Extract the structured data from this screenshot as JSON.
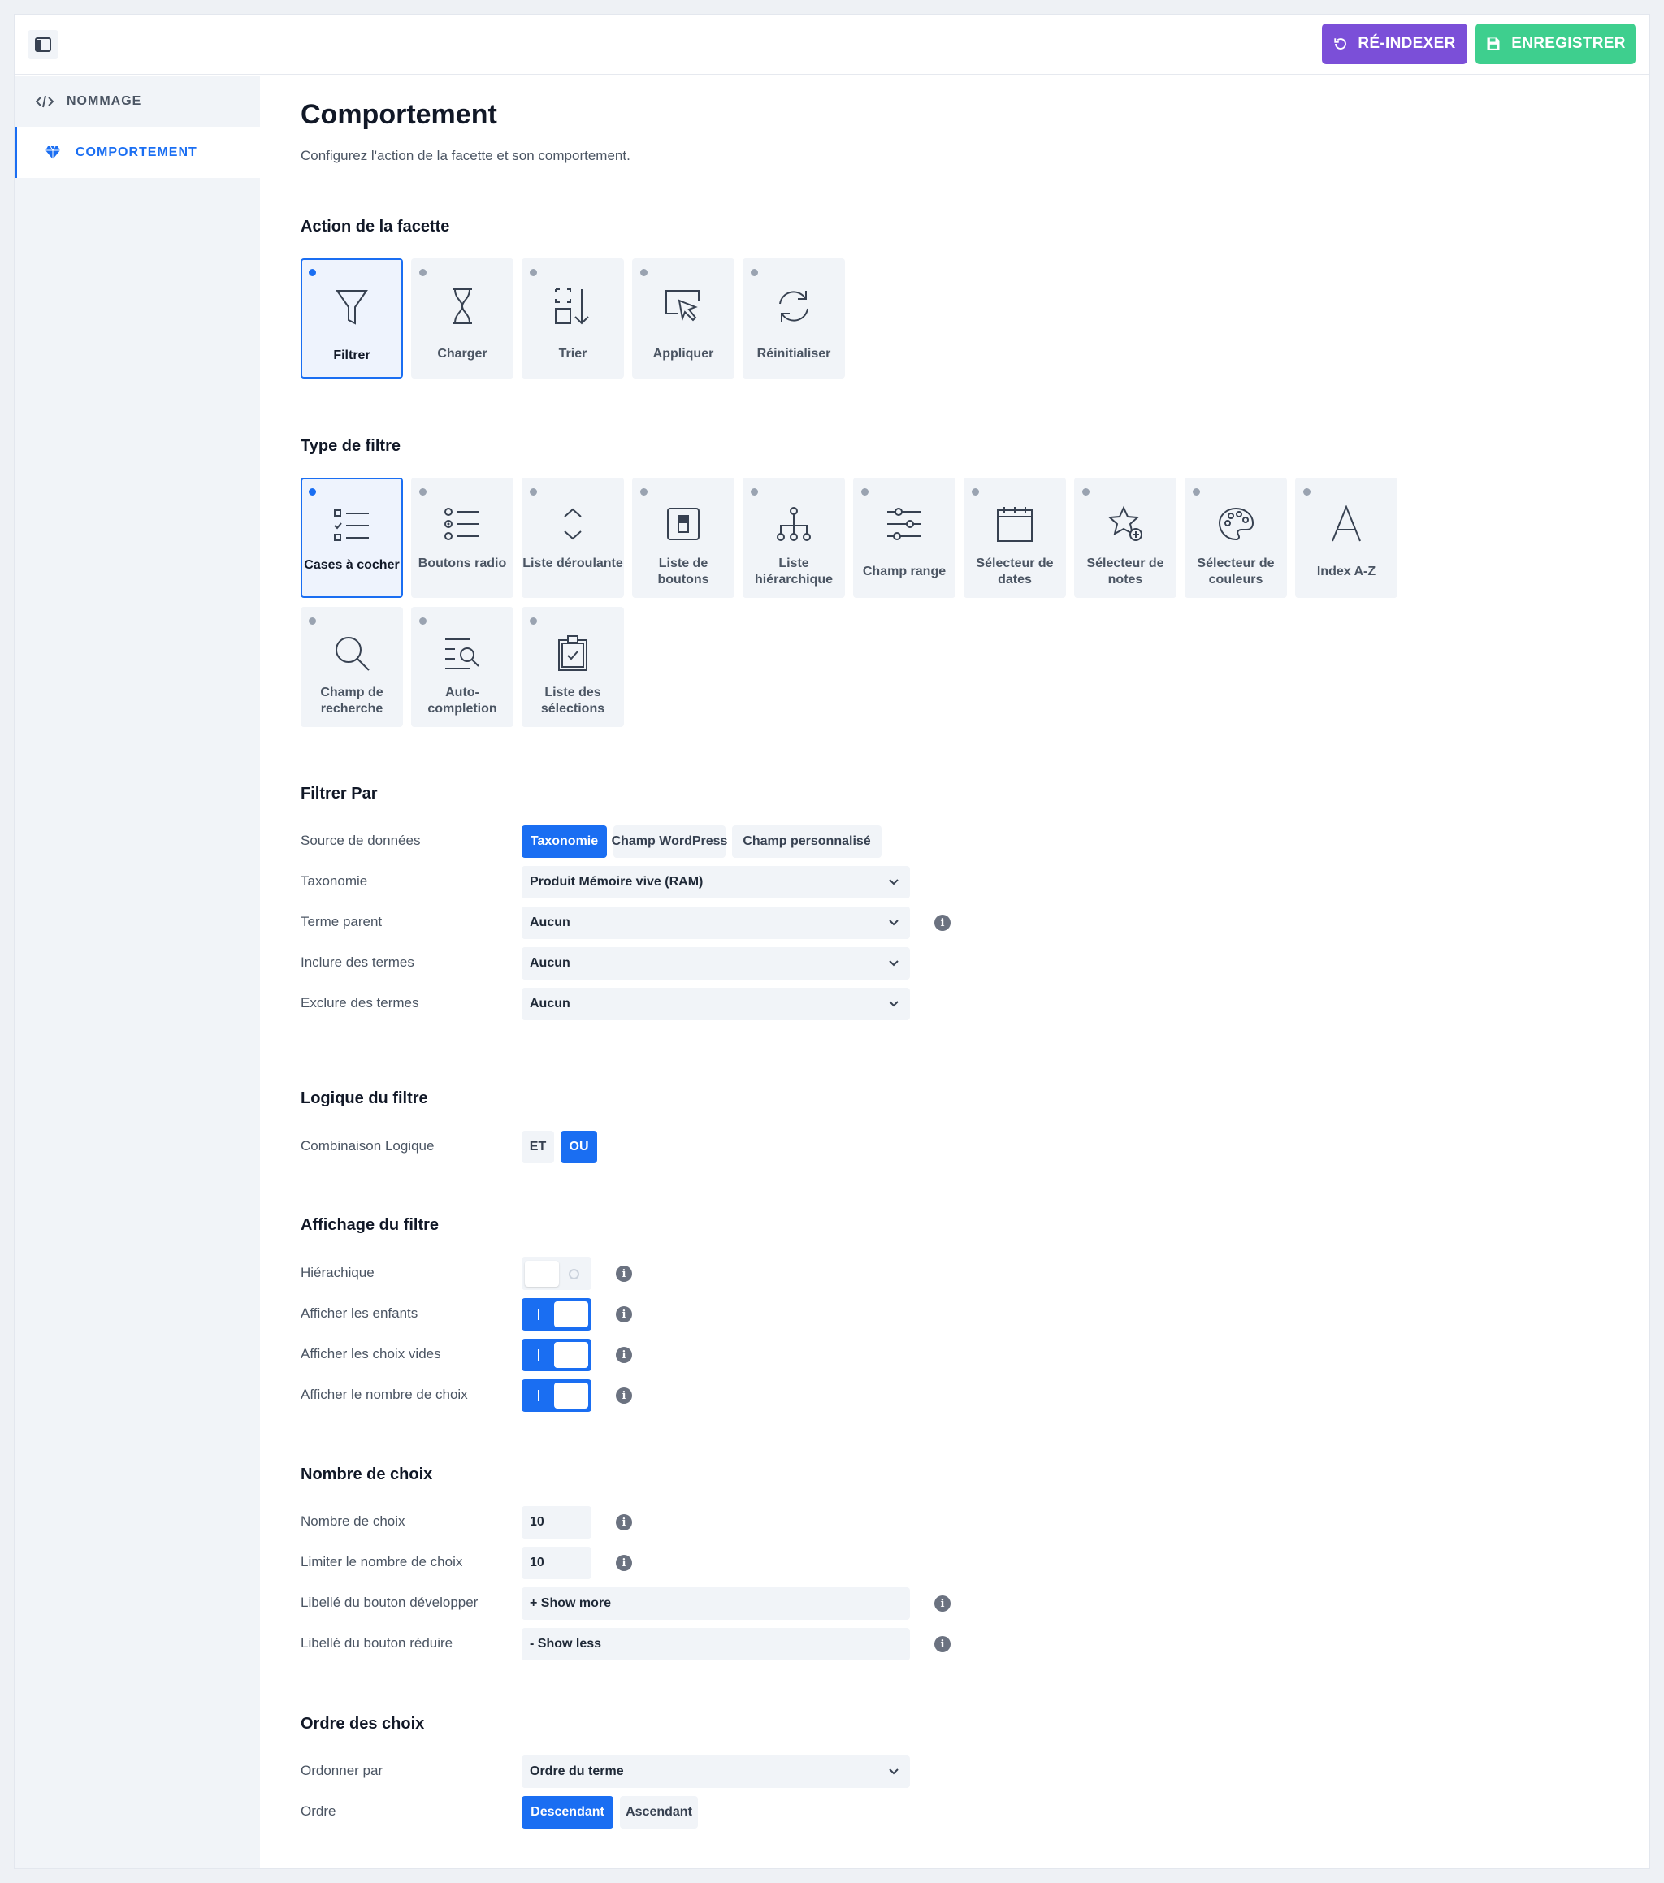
{
  "topbar": {
    "reindex_label": "RÉ-INDEXER",
    "save_label": "ENREGISTRER"
  },
  "sidebar": {
    "items": [
      {
        "label": "NOMMAGE"
      },
      {
        "label": "COMPORTEMENT"
      }
    ]
  },
  "page": {
    "title": "Comportement",
    "subtitle": "Configurez l'action de la facette et son comportement."
  },
  "action": {
    "title": "Action de la facette",
    "options": [
      {
        "label": "Filtrer",
        "icon": "funnel-icon",
        "selected": true
      },
      {
        "label": "Charger",
        "icon": "hourglass-icon"
      },
      {
        "label": "Trier",
        "icon": "sort-icon"
      },
      {
        "label": "Appliquer",
        "icon": "cursor-icon"
      },
      {
        "label": "Réinitialiser",
        "icon": "refresh-icon"
      }
    ]
  },
  "filter_type": {
    "title": "Type de filtre",
    "options": [
      {
        "label": "Cases à cocher",
        "icon": "checkbox-list-icon",
        "selected": true
      },
      {
        "label": "Boutons radio",
        "icon": "radio-list-icon"
      },
      {
        "label": "Liste déroulante",
        "icon": "dropdown-icon"
      },
      {
        "label": "Liste de boutons",
        "icon": "button-icon"
      },
      {
        "label": "Liste hiérarchique",
        "icon": "hierarchy-icon"
      },
      {
        "label": "Champ range",
        "icon": "sliders-icon"
      },
      {
        "label": "Sélecteur de dates",
        "icon": "calendar-icon"
      },
      {
        "label": "Sélecteur de notes",
        "icon": "star-icon"
      },
      {
        "label": "Sélecteur de couleurs",
        "icon": "palette-icon"
      },
      {
        "label": "Index A-Z",
        "icon": "letter-a-icon"
      },
      {
        "label": "Champ de recherche",
        "icon": "search-icon"
      },
      {
        "label": "Auto-completion",
        "icon": "text-search-icon"
      },
      {
        "label": "Liste des sélections",
        "icon": "clipboard-check-icon"
      }
    ]
  },
  "filter_by": {
    "title": "Filtrer Par",
    "source_label": "Source de données",
    "sources": [
      "Taxonomie",
      "Champ WordPress",
      "Champ personnalisé"
    ],
    "taxonomy_label": "Taxonomie",
    "taxonomy_value": "Produit Mémoire vive (RAM)",
    "parent_label": "Terme parent",
    "parent_value": "Aucun",
    "include_label": "Inclure des termes",
    "include_value": "Aucun",
    "exclude_label": "Exclure des termes",
    "exclude_value": "Aucun"
  },
  "logic": {
    "title": "Logique du filtre",
    "label": "Combinaison Logique",
    "options": [
      "ET",
      "OU"
    ]
  },
  "display": {
    "title": "Affichage du filtre",
    "hierarchical_label": "Hiérachique",
    "children_label": "Afficher les enfants",
    "empty_label": "Afficher les choix vides",
    "count_label": "Afficher le nombre de choix"
  },
  "choices": {
    "title": "Nombre de choix",
    "number_label": "Nombre de choix",
    "number_value": "10",
    "limit_label": "Limiter le nombre de choix",
    "limit_value": "10",
    "more_label": "Libellé du bouton développer",
    "more_value": "+ Show more",
    "less_label": "Libellé du bouton réduire",
    "less_value": "- Show less"
  },
  "order": {
    "title": "Ordre des choix",
    "by_label": "Ordonner par",
    "by_value": "Ordre du terme",
    "order_label": "Ordre",
    "options": [
      "Descendant",
      "Ascendant"
    ]
  },
  "colors": {
    "accent": "#1a6ef2",
    "reindex": "#7b4fd8",
    "save": "#3ecf8e"
  }
}
